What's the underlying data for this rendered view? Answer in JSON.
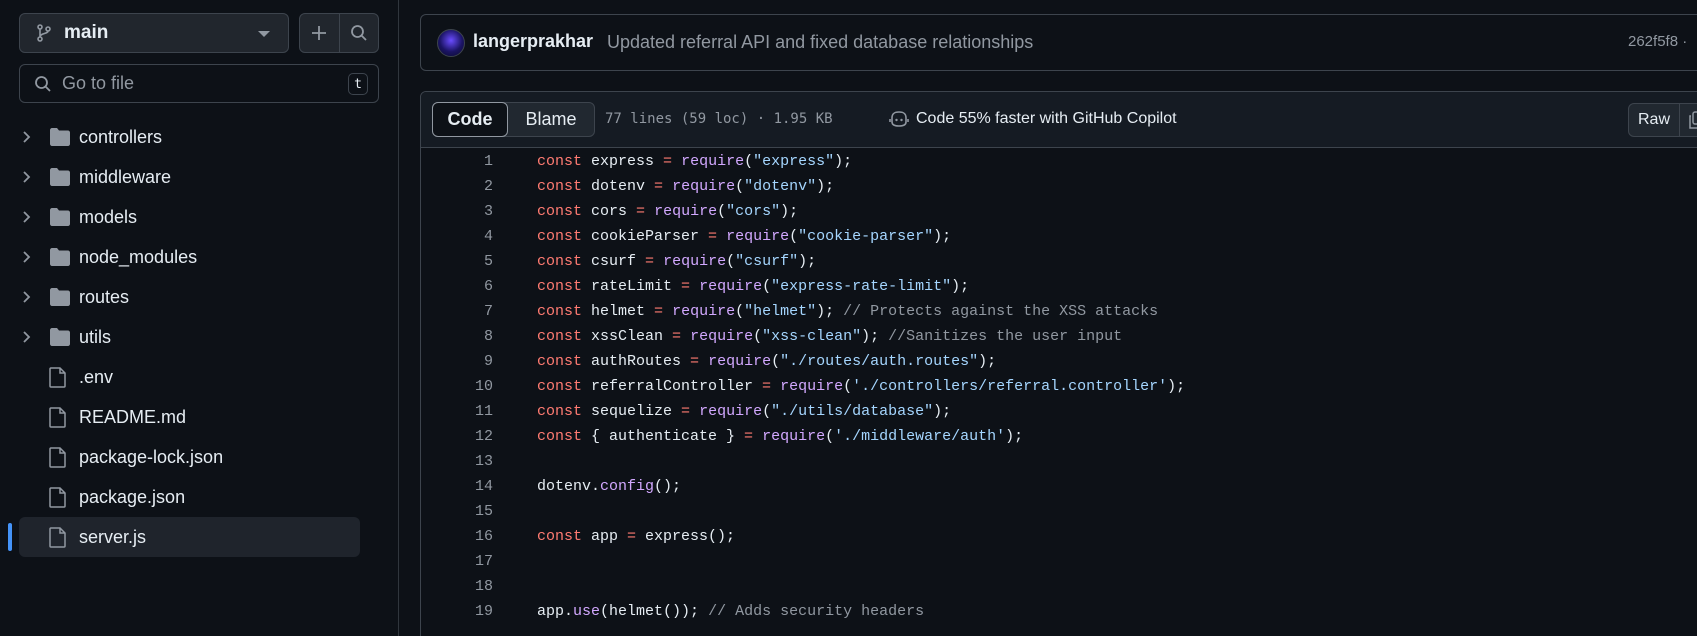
{
  "sidebar": {
    "branch": "main",
    "add_icon": "plus-icon",
    "search_icon": "search-icon",
    "goto_placeholder": "Go to file",
    "goto_shortcut": "t",
    "items": [
      {
        "label": "controllers",
        "type": "folder"
      },
      {
        "label": "middleware",
        "type": "folder"
      },
      {
        "label": "models",
        "type": "folder"
      },
      {
        "label": "node_modules",
        "type": "folder"
      },
      {
        "label": "routes",
        "type": "folder"
      },
      {
        "label": "utils",
        "type": "folder"
      },
      {
        "label": ".env",
        "type": "file"
      },
      {
        "label": "README.md",
        "type": "file"
      },
      {
        "label": "package-lock.json",
        "type": "file"
      },
      {
        "label": "package.json",
        "type": "file"
      },
      {
        "label": "server.js",
        "type": "file",
        "selected": true
      }
    ]
  },
  "commit": {
    "author": "langerprakhar",
    "message": "Updated referral API and fixed database relationships",
    "sha": "262f5f8 ·"
  },
  "file": {
    "tab_code": "Code",
    "tab_blame": "Blame",
    "info": "77 lines (59 loc) · 1.95 KB",
    "copilot": "Code 55% faster with GitHub Copilot",
    "raw": "Raw"
  },
  "code_lines": [
    [
      [
        "kw",
        "const"
      ],
      [
        "id",
        " express "
      ],
      [
        "op",
        "="
      ],
      [
        "id",
        " "
      ],
      [
        "fn",
        "require"
      ],
      [
        "id",
        "("
      ],
      [
        "str",
        "\"express\""
      ],
      [
        "id",
        ");"
      ]
    ],
    [
      [
        "kw",
        "const"
      ],
      [
        "id",
        " dotenv "
      ],
      [
        "op",
        "="
      ],
      [
        "id",
        " "
      ],
      [
        "fn",
        "require"
      ],
      [
        "id",
        "("
      ],
      [
        "str",
        "\"dotenv\""
      ],
      [
        "id",
        ");"
      ]
    ],
    [
      [
        "kw",
        "const"
      ],
      [
        "id",
        " cors "
      ],
      [
        "op",
        "="
      ],
      [
        "id",
        " "
      ],
      [
        "fn",
        "require"
      ],
      [
        "id",
        "("
      ],
      [
        "str",
        "\"cors\""
      ],
      [
        "id",
        ");"
      ]
    ],
    [
      [
        "kw",
        "const"
      ],
      [
        "id",
        " cookieParser "
      ],
      [
        "op",
        "="
      ],
      [
        "id",
        " "
      ],
      [
        "fn",
        "require"
      ],
      [
        "id",
        "("
      ],
      [
        "str",
        "\"cookie-parser\""
      ],
      [
        "id",
        ");"
      ]
    ],
    [
      [
        "kw",
        "const"
      ],
      [
        "id",
        " csurf "
      ],
      [
        "op",
        "="
      ],
      [
        "id",
        " "
      ],
      [
        "fn",
        "require"
      ],
      [
        "id",
        "("
      ],
      [
        "str",
        "\"csurf\""
      ],
      [
        "id",
        ");"
      ]
    ],
    [
      [
        "kw",
        "const"
      ],
      [
        "id",
        " rateLimit "
      ],
      [
        "op",
        "="
      ],
      [
        "id",
        " "
      ],
      [
        "fn",
        "require"
      ],
      [
        "id",
        "("
      ],
      [
        "str",
        "\"express-rate-limit\""
      ],
      [
        "id",
        ");"
      ]
    ],
    [
      [
        "kw",
        "const"
      ],
      [
        "id",
        " helmet "
      ],
      [
        "op",
        "="
      ],
      [
        "id",
        " "
      ],
      [
        "fn",
        "require"
      ],
      [
        "id",
        "("
      ],
      [
        "str",
        "\"helmet\""
      ],
      [
        "id",
        "); "
      ],
      [
        "cm",
        "// Protects against the XSS attacks"
      ]
    ],
    [
      [
        "kw",
        "const"
      ],
      [
        "id",
        " xssClean "
      ],
      [
        "op",
        "="
      ],
      [
        "id",
        " "
      ],
      [
        "fn",
        "require"
      ],
      [
        "id",
        "("
      ],
      [
        "str",
        "\"xss-clean\""
      ],
      [
        "id",
        "); "
      ],
      [
        "cm",
        "//Sanitizes the user input"
      ]
    ],
    [
      [
        "kw",
        "const"
      ],
      [
        "id",
        " authRoutes "
      ],
      [
        "op",
        "="
      ],
      [
        "id",
        " "
      ],
      [
        "fn",
        "require"
      ],
      [
        "id",
        "("
      ],
      [
        "str",
        "\"./routes/auth.routes\""
      ],
      [
        "id",
        ");"
      ]
    ],
    [
      [
        "kw",
        "const"
      ],
      [
        "id",
        " referralController "
      ],
      [
        "op",
        "="
      ],
      [
        "id",
        " "
      ],
      [
        "fn",
        "require"
      ],
      [
        "id",
        "("
      ],
      [
        "str",
        "'./controllers/referral.controller'"
      ],
      [
        "id",
        ");"
      ]
    ],
    [
      [
        "kw",
        "const"
      ],
      [
        "id",
        " sequelize "
      ],
      [
        "op",
        "="
      ],
      [
        "id",
        " "
      ],
      [
        "fn",
        "require"
      ],
      [
        "id",
        "("
      ],
      [
        "str",
        "\"./utils/database\""
      ],
      [
        "id",
        ");"
      ]
    ],
    [
      [
        "kw",
        "const"
      ],
      [
        "id",
        " { authenticate } "
      ],
      [
        "op",
        "="
      ],
      [
        "id",
        " "
      ],
      [
        "fn",
        "require"
      ],
      [
        "id",
        "("
      ],
      [
        "str",
        "'./middleware/auth'"
      ],
      [
        "id",
        ");"
      ]
    ],
    [],
    [
      [
        "id",
        "dotenv."
      ],
      [
        "fn",
        "config"
      ],
      [
        "id",
        "();"
      ]
    ],
    [],
    [
      [
        "kw",
        "const"
      ],
      [
        "id",
        " app "
      ],
      [
        "op",
        "="
      ],
      [
        "id",
        " express();"
      ]
    ],
    [],
    [],
    [
      [
        "id",
        "app."
      ],
      [
        "fn",
        "use"
      ],
      [
        "id",
        "(helmet()); "
      ],
      [
        "cm",
        "// Adds security headers"
      ]
    ]
  ]
}
